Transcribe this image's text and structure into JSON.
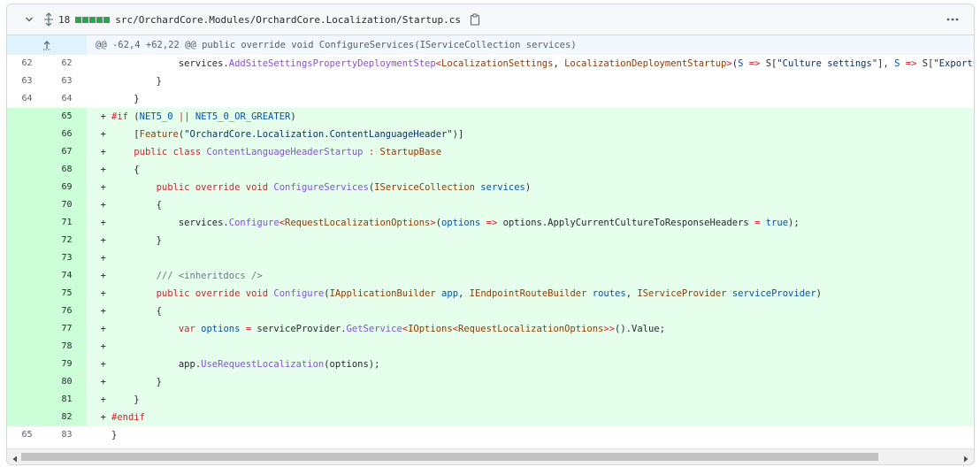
{
  "file_header": {
    "change_count": "18",
    "diffstat_colors": [
      "#2da44e",
      "#2da44e",
      "#2da44e",
      "#2da44e",
      "#2da44e"
    ],
    "path": "src/OrchardCore.Modules/OrchardCore.Localization/Startup.cs"
  },
  "hunk": {
    "header": "@@ -62,4 +62,22 @@ public override void ConfigureServices(IServiceCollection services)"
  },
  "lines": [
    {
      "old": "62",
      "new": "62",
      "type": "ctx",
      "mark": " ",
      "indent": "            ",
      "tokens": [
        {
          "c": "p",
          "t": "services."
        },
        {
          "c": "f",
          "t": "AddSiteSettingsPropertyDeploymentStep"
        },
        {
          "c": "k",
          "t": "<"
        },
        {
          "c": "t",
          "t": "LocalizationSettings"
        },
        {
          "c": "p",
          "t": ", "
        },
        {
          "c": "t",
          "t": "LocalizationDeploymentStartup"
        },
        {
          "c": "k",
          "t": ">"
        },
        {
          "c": "p",
          "t": "("
        },
        {
          "c": "c",
          "t": "S"
        },
        {
          "c": "p",
          "t": " "
        },
        {
          "c": "k",
          "t": "=>"
        },
        {
          "c": "p",
          "t": " S["
        },
        {
          "c": "s",
          "t": "\"Culture settings\""
        },
        {
          "c": "p",
          "t": "], "
        },
        {
          "c": "c",
          "t": "S"
        },
        {
          "c": "p",
          "t": " "
        },
        {
          "c": "k",
          "t": "=>"
        },
        {
          "c": "p",
          "t": " S["
        },
        {
          "c": "s",
          "t": "\"Exports the cultur"
        }
      ]
    },
    {
      "old": "63",
      "new": "63",
      "type": "ctx",
      "mark": " ",
      "indent": "        ",
      "tokens": [
        {
          "c": "p",
          "t": "}"
        }
      ]
    },
    {
      "old": "64",
      "new": "64",
      "type": "ctx",
      "mark": " ",
      "indent": "    ",
      "tokens": [
        {
          "c": "p",
          "t": "}"
        }
      ]
    },
    {
      "old": "",
      "new": "65",
      "type": "add",
      "mark": "+",
      "indent": "",
      "tokens": [
        {
          "c": "k",
          "t": "#if"
        },
        {
          "c": "p",
          "t": " ("
        },
        {
          "c": "c",
          "t": "NET5_0"
        },
        {
          "c": "p",
          "t": " "
        },
        {
          "c": "k",
          "t": "||"
        },
        {
          "c": "p",
          "t": " "
        },
        {
          "c": "c",
          "t": "NET5_0_OR_GREATER"
        },
        {
          "c": "p",
          "t": ")"
        }
      ]
    },
    {
      "old": "",
      "new": "66",
      "type": "add",
      "mark": "+",
      "indent": "    ",
      "tokens": [
        {
          "c": "p",
          "t": "["
        },
        {
          "c": "t",
          "t": "Feature"
        },
        {
          "c": "p",
          "t": "("
        },
        {
          "c": "s",
          "t": "\"OrchardCore.Localization.ContentLanguageHeader\""
        },
        {
          "c": "p",
          "t": ")]"
        }
      ]
    },
    {
      "old": "",
      "new": "67",
      "type": "add",
      "mark": "+",
      "indent": "    ",
      "tokens": [
        {
          "c": "k",
          "t": "public"
        },
        {
          "c": "p",
          "t": " "
        },
        {
          "c": "k",
          "t": "class"
        },
        {
          "c": "p",
          "t": " "
        },
        {
          "c": "f",
          "t": "ContentLanguageHeaderStartup"
        },
        {
          "c": "p",
          "t": " "
        },
        {
          "c": "k",
          "t": ":"
        },
        {
          "c": "p",
          "t": " "
        },
        {
          "c": "t",
          "t": "StartupBase"
        }
      ]
    },
    {
      "old": "",
      "new": "68",
      "type": "add",
      "mark": "+",
      "indent": "    ",
      "tokens": [
        {
          "c": "p",
          "t": "{"
        }
      ]
    },
    {
      "old": "",
      "new": "69",
      "type": "add",
      "mark": "+",
      "indent": "        ",
      "tokens": [
        {
          "c": "k",
          "t": "public"
        },
        {
          "c": "p",
          "t": " "
        },
        {
          "c": "k",
          "t": "override"
        },
        {
          "c": "p",
          "t": " "
        },
        {
          "c": "k",
          "t": "void"
        },
        {
          "c": "p",
          "t": " "
        },
        {
          "c": "f",
          "t": "ConfigureServices"
        },
        {
          "c": "p",
          "t": "("
        },
        {
          "c": "t",
          "t": "IServiceCollection"
        },
        {
          "c": "p",
          "t": " "
        },
        {
          "c": "c",
          "t": "services"
        },
        {
          "c": "p",
          "t": ")"
        }
      ]
    },
    {
      "old": "",
      "new": "70",
      "type": "add",
      "mark": "+",
      "indent": "        ",
      "tokens": [
        {
          "c": "p",
          "t": "{"
        }
      ]
    },
    {
      "old": "",
      "new": "71",
      "type": "add",
      "mark": "+",
      "indent": "            ",
      "tokens": [
        {
          "c": "p",
          "t": "services."
        },
        {
          "c": "f",
          "t": "Configure"
        },
        {
          "c": "k",
          "t": "<"
        },
        {
          "c": "t",
          "t": "RequestLocalizationOptions"
        },
        {
          "c": "k",
          "t": ">"
        },
        {
          "c": "p",
          "t": "("
        },
        {
          "c": "c",
          "t": "options"
        },
        {
          "c": "p",
          "t": " "
        },
        {
          "c": "k",
          "t": "=>"
        },
        {
          "c": "p",
          "t": " options.ApplyCurrentCultureToResponseHeaders "
        },
        {
          "c": "k",
          "t": "="
        },
        {
          "c": "p",
          "t": " "
        },
        {
          "c": "c",
          "t": "true"
        },
        {
          "c": "p",
          "t": ");"
        }
      ]
    },
    {
      "old": "",
      "new": "72",
      "type": "add",
      "mark": "+",
      "indent": "        ",
      "tokens": [
        {
          "c": "p",
          "t": "}"
        }
      ]
    },
    {
      "old": "",
      "new": "73",
      "type": "add",
      "mark": "+",
      "indent": "",
      "tokens": []
    },
    {
      "old": "",
      "new": "74",
      "type": "add",
      "mark": "+",
      "indent": "        ",
      "tokens": [
        {
          "c": "cm",
          "t": "/// <inheritdocs />"
        }
      ]
    },
    {
      "old": "",
      "new": "75",
      "type": "add",
      "mark": "+",
      "indent": "        ",
      "tokens": [
        {
          "c": "k",
          "t": "public"
        },
        {
          "c": "p",
          "t": " "
        },
        {
          "c": "k",
          "t": "override"
        },
        {
          "c": "p",
          "t": " "
        },
        {
          "c": "k",
          "t": "void"
        },
        {
          "c": "p",
          "t": " "
        },
        {
          "c": "f",
          "t": "Configure"
        },
        {
          "c": "p",
          "t": "("
        },
        {
          "c": "t",
          "t": "IApplicationBuilder"
        },
        {
          "c": "p",
          "t": " "
        },
        {
          "c": "c",
          "t": "app"
        },
        {
          "c": "p",
          "t": ", "
        },
        {
          "c": "t",
          "t": "IEndpointRouteBuilder"
        },
        {
          "c": "p",
          "t": " "
        },
        {
          "c": "c",
          "t": "routes"
        },
        {
          "c": "p",
          "t": ", "
        },
        {
          "c": "t",
          "t": "IServiceProvider"
        },
        {
          "c": "p",
          "t": " "
        },
        {
          "c": "c",
          "t": "serviceProvider"
        },
        {
          "c": "p",
          "t": ")"
        }
      ]
    },
    {
      "old": "",
      "new": "76",
      "type": "add",
      "mark": "+",
      "indent": "        ",
      "tokens": [
        {
          "c": "p",
          "t": "{"
        }
      ]
    },
    {
      "old": "",
      "new": "77",
      "type": "add",
      "mark": "+",
      "indent": "            ",
      "tokens": [
        {
          "c": "k",
          "t": "var"
        },
        {
          "c": "p",
          "t": " "
        },
        {
          "c": "c",
          "t": "options"
        },
        {
          "c": "p",
          "t": " "
        },
        {
          "c": "k",
          "t": "="
        },
        {
          "c": "p",
          "t": " serviceProvider."
        },
        {
          "c": "f",
          "t": "GetService"
        },
        {
          "c": "k",
          "t": "<"
        },
        {
          "c": "t",
          "t": "IOptions"
        },
        {
          "c": "k",
          "t": "<"
        },
        {
          "c": "t",
          "t": "RequestLocalizationOptions"
        },
        {
          "c": "k",
          "t": ">>"
        },
        {
          "c": "p",
          "t": "().Value;"
        }
      ]
    },
    {
      "old": "",
      "new": "78",
      "type": "add",
      "mark": "+",
      "indent": "",
      "tokens": []
    },
    {
      "old": "",
      "new": "79",
      "type": "add",
      "mark": "+",
      "indent": "            ",
      "tokens": [
        {
          "c": "p",
          "t": "app."
        },
        {
          "c": "f",
          "t": "UseRequestLocalization"
        },
        {
          "c": "p",
          "t": "(options);"
        }
      ]
    },
    {
      "old": "",
      "new": "80",
      "type": "add",
      "mark": "+",
      "indent": "        ",
      "tokens": [
        {
          "c": "p",
          "t": "}"
        }
      ]
    },
    {
      "old": "",
      "new": "81",
      "type": "add",
      "mark": "+",
      "indent": "    ",
      "tokens": [
        {
          "c": "p",
          "t": "}"
        }
      ]
    },
    {
      "old": "",
      "new": "82",
      "type": "add",
      "mark": "+",
      "indent": "",
      "tokens": [
        {
          "c": "k",
          "t": "#endif"
        }
      ]
    },
    {
      "old": "65",
      "new": "83",
      "type": "ctx",
      "mark": " ",
      "indent": "",
      "tokens": [
        {
          "c": "p",
          "t": "}"
        }
      ]
    }
  ]
}
